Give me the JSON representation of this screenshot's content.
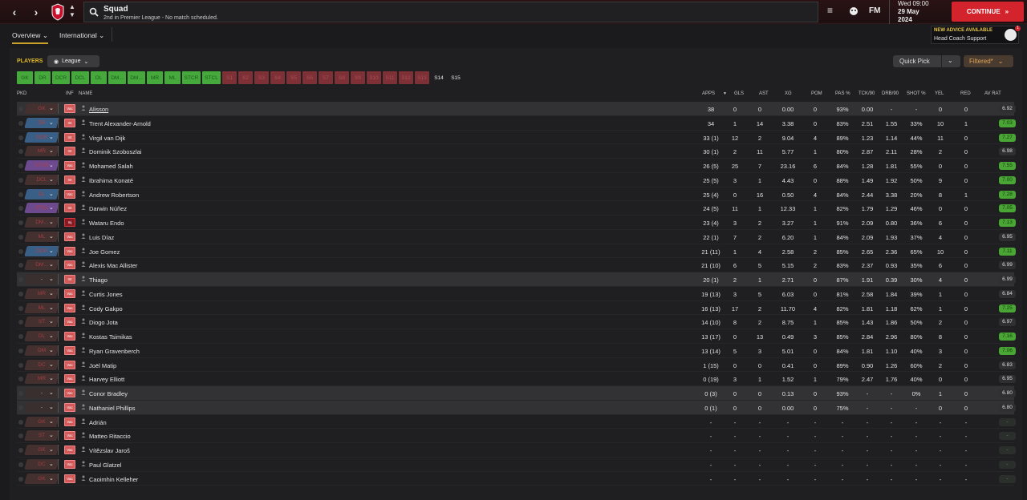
{
  "topbar": {
    "title": "Squad",
    "subtitle": "2nd in Premier League - No match scheduled.",
    "fm_label": "FM",
    "day_time": "Wed 09:00",
    "date_line1": "29 May",
    "date_line2": "2024",
    "continue_label": "CONTINUE",
    "accent": "#d3232d"
  },
  "tabs": {
    "overview": "Overview",
    "international": "International"
  },
  "advice": {
    "title": "NEW ADVICE AVAILABLE",
    "text": "Head Coach Support",
    "badge": "1"
  },
  "toolbar": {
    "players_label": "PLAYERS",
    "league": "League",
    "quick_pick": "Quick Pick",
    "filtered": "Filtered*"
  },
  "positions": [
    {
      "label": "GK",
      "state": "g"
    },
    {
      "label": "DR",
      "state": "g"
    },
    {
      "label": "DCR",
      "state": "g"
    },
    {
      "label": "DCL",
      "state": "g"
    },
    {
      "label": "DL",
      "state": "g"
    },
    {
      "label": "DM...",
      "state": "g"
    },
    {
      "label": "DM...",
      "state": "g"
    },
    {
      "label": "MR",
      "state": "g"
    },
    {
      "label": "ML",
      "state": "g"
    },
    {
      "label": "STCR",
      "state": "g"
    },
    {
      "label": "STCL",
      "state": "g"
    },
    {
      "label": "S1",
      "state": "r"
    },
    {
      "label": "S2",
      "state": "r"
    },
    {
      "label": "S3",
      "state": "r"
    },
    {
      "label": "S4",
      "state": "r"
    },
    {
      "label": "S5",
      "state": "r"
    },
    {
      "label": "S6",
      "state": "r"
    },
    {
      "label": "S7",
      "state": "r"
    },
    {
      "label": "S8",
      "state": "r"
    },
    {
      "label": "S9",
      "state": "r"
    },
    {
      "label": "S10",
      "state": "r"
    },
    {
      "label": "S11",
      "state": "r"
    },
    {
      "label": "S12",
      "state": "r"
    },
    {
      "label": "S13",
      "state": "r"
    },
    {
      "label": "S14",
      "state": "d"
    },
    {
      "label": "S15",
      "state": "d"
    }
  ],
  "columns": {
    "pkd": "PKD",
    "inf": "INF",
    "name": "NAME",
    "apps": "APPS",
    "gls": "GLS",
    "ast": "AST",
    "xg": "XG",
    "pom": "POM",
    "pas": "PAS %",
    "tck": "TCK/90",
    "drb": "DRB/90",
    "shot": "SHOT %",
    "yel": "YEL",
    "red": "RED",
    "avrat": "AV RAT"
  },
  "players": [
    {
      "pos": "GK",
      "pc": "brown",
      "inf": "Vac",
      "name": "Alisson",
      "apps": "38",
      "gls": "0",
      "ast": "0",
      "xg": "0.00",
      "pom": "0",
      "pas": "93%",
      "tck": "0.00",
      "drb": "-",
      "shot": "-",
      "yel": "0",
      "red": "0",
      "rat": "6.92",
      "rc": "grey",
      "hl": true
    },
    {
      "pos": "DR",
      "pc": "blue",
      "inf": "Int",
      "name": "Trent Alexander-Arnold",
      "apps": "34",
      "gls": "1",
      "ast": "14",
      "xg": "3.38",
      "pom": "0",
      "pas": "83%",
      "tck": "2.51",
      "drb": "1.55",
      "shot": "33%",
      "yel": "10",
      "red": "1",
      "rat": "7.03",
      "rc": "green"
    },
    {
      "pos": "DCR",
      "pc": "blue",
      "inf": "Int",
      "name": "Virgil van Dijk",
      "apps": "33 (1)",
      "gls": "12",
      "ast": "2",
      "xg": "9.04",
      "pom": "4",
      "pas": "89%",
      "tck": "1.23",
      "drb": "1.14",
      "shot": "44%",
      "yel": "11",
      "red": "0",
      "rat": "7.27",
      "rc": "green"
    },
    {
      "pos": "MR",
      "pc": "brown",
      "inf": "Int",
      "name": "Dominik Szoboszlai",
      "apps": "30 (1)",
      "gls": "2",
      "ast": "11",
      "xg": "5.77",
      "pom": "1",
      "pas": "80%",
      "tck": "2.87",
      "drb": "2.11",
      "shot": "28%",
      "yel": "2",
      "red": "0",
      "rat": "6.98",
      "rc": "grey"
    },
    {
      "pos": "STCR",
      "pc": "purple",
      "inf": "Vac",
      "name": "Mohamed Salah",
      "apps": "26 (5)",
      "gls": "25",
      "ast": "7",
      "xg": "23.16",
      "pom": "6",
      "pas": "84%",
      "tck": "1.28",
      "drb": "1.81",
      "shot": "55%",
      "yel": "0",
      "red": "0",
      "rat": "7.55",
      "rc": "green"
    },
    {
      "pos": "DCL",
      "pc": "brown",
      "inf": "Int",
      "name": "Ibrahima Konaté",
      "apps": "25 (5)",
      "gls": "3",
      "ast": "1",
      "xg": "4.43",
      "pom": "0",
      "pas": "88%",
      "tck": "1.49",
      "drb": "1.92",
      "shot": "50%",
      "yel": "9",
      "red": "0",
      "rat": "7.00",
      "rc": "green"
    },
    {
      "pos": "DL",
      "pc": "blue",
      "inf": "Vac",
      "name": "Andrew Robertson",
      "apps": "25 (4)",
      "gls": "0",
      "ast": "16",
      "xg": "0.50",
      "pom": "4",
      "pas": "84%",
      "tck": "2.44",
      "drb": "3.38",
      "shot": "20%",
      "yel": "8",
      "red": "1",
      "rat": "7.28",
      "rc": "green"
    },
    {
      "pos": "STCL",
      "pc": "purple",
      "inf": "Int",
      "name": "Darwin Núñez",
      "apps": "24 (5)",
      "gls": "11",
      "ast": "1",
      "xg": "12.33",
      "pom": "1",
      "pas": "82%",
      "tck": "1.79",
      "drb": "1.29",
      "shot": "46%",
      "yel": "0",
      "red": "0",
      "rat": "7.05",
      "rc": "green"
    },
    {
      "pos": "DM...",
      "pc": "brown",
      "inf": "Inj",
      "inf_dark": true,
      "name": "Wataru Endo",
      "apps": "23 (4)",
      "gls": "3",
      "ast": "2",
      "xg": "3.27",
      "pom": "1",
      "pas": "91%",
      "tck": "2.09",
      "drb": "0.80",
      "shot": "36%",
      "yel": "6",
      "red": "0",
      "rat": "7.13",
      "rc": "green"
    },
    {
      "pos": "ML",
      "pc": "brown",
      "inf": "Vac",
      "name": "Luis Díaz",
      "apps": "22 (1)",
      "gls": "7",
      "ast": "2",
      "xg": "6.20",
      "pom": "1",
      "pas": "84%",
      "tck": "2.09",
      "drb": "1.93",
      "shot": "37%",
      "yel": "4",
      "red": "0",
      "rat": "6.95",
      "rc": "grey"
    },
    {
      "pos": "DCR",
      "pc": "blue",
      "inf": "Vac",
      "name": "Joe Gomez",
      "apps": "21 (11)",
      "gls": "1",
      "ast": "4",
      "xg": "2.58",
      "pom": "2",
      "pas": "85%",
      "tck": "2.65",
      "drb": "2.36",
      "shot": "65%",
      "yel": "10",
      "red": "0",
      "rat": "7.11",
      "rc": "green"
    },
    {
      "pos": "DM...",
      "pc": "brown",
      "inf": "Vac",
      "name": "Alexis Mac Allister",
      "apps": "21 (10)",
      "gls": "6",
      "ast": "5",
      "xg": "5.15",
      "pom": "2",
      "pas": "83%",
      "tck": "2.37",
      "drb": "0.93",
      "shot": "35%",
      "yel": "6",
      "red": "0",
      "rat": "6.99",
      "rc": "grey"
    },
    {
      "pos": "-",
      "pc": "dark",
      "inf": "Int",
      "name": "Thiago",
      "apps": "20 (1)",
      "gls": "2",
      "ast": "1",
      "xg": "2.71",
      "pom": "0",
      "pas": "87%",
      "tck": "1.91",
      "drb": "0.39",
      "shot": "30%",
      "yel": "4",
      "red": "0",
      "rat": "6.99",
      "rc": "grey",
      "hl": true
    },
    {
      "pos": "MR",
      "pc": "brown",
      "inf": "Vac",
      "name": "Curtis Jones",
      "apps": "19 (13)",
      "gls": "3",
      "ast": "5",
      "xg": "6.03",
      "pom": "0",
      "pas": "81%",
      "tck": "2.58",
      "drb": "1.84",
      "shot": "39%",
      "yel": "1",
      "red": "0",
      "rat": "6.84",
      "rc": "grey"
    },
    {
      "pos": "ML",
      "pc": "brown",
      "inf": "Vac",
      "name": "Cody Gakpo",
      "apps": "16 (13)",
      "gls": "17",
      "ast": "2",
      "xg": "11.70",
      "pom": "4",
      "pas": "82%",
      "tck": "1.81",
      "drb": "1.18",
      "shot": "62%",
      "yel": "1",
      "red": "0",
      "rat": "7.25",
      "rc": "green"
    },
    {
      "pos": "ST",
      "pc": "brown",
      "inf": "Vac",
      "name": "Diogo Jota",
      "apps": "14 (10)",
      "gls": "8",
      "ast": "2",
      "xg": "8.75",
      "pom": "1",
      "pas": "85%",
      "tck": "1.43",
      "drb": "1.86",
      "shot": "50%",
      "yel": "2",
      "red": "0",
      "rat": "6.97",
      "rc": "grey"
    },
    {
      "pos": "DL",
      "pc": "brown",
      "inf": "Vac",
      "name": "Kostas Tsimikas",
      "apps": "13 (17)",
      "gls": "0",
      "ast": "13",
      "xg": "0.49",
      "pom": "3",
      "pas": "85%",
      "tck": "2.84",
      "drb": "2.96",
      "shot": "80%",
      "yel": "8",
      "red": "0",
      "rat": "7.16",
      "rc": "green"
    },
    {
      "pos": "DM",
      "pc": "brown",
      "inf": "Vac",
      "name": "Ryan Gravenberch",
      "apps": "13 (14)",
      "gls": "5",
      "ast": "3",
      "xg": "5.01",
      "pom": "0",
      "pas": "84%",
      "tck": "1.81",
      "drb": "1.10",
      "shot": "40%",
      "yel": "3",
      "red": "0",
      "rat": "7.06",
      "rc": "green"
    },
    {
      "pos": "DC",
      "pc": "brown",
      "inf": "Vac",
      "name": "Joël Matip",
      "apps": "1 (15)",
      "gls": "0",
      "ast": "0",
      "xg": "0.41",
      "pom": "0",
      "pas": "89%",
      "tck": "0.90",
      "drb": "1.26",
      "shot": "60%",
      "yel": "2",
      "red": "0",
      "rat": "6.83",
      "rc": "grey"
    },
    {
      "pos": "MR",
      "pc": "brown",
      "inf": "Vac",
      "name": "Harvey Elliott",
      "apps": "0 (19)",
      "gls": "3",
      "ast": "1",
      "xg": "1.52",
      "pom": "1",
      "pas": "79%",
      "tck": "2.47",
      "drb": "1.76",
      "shot": "40%",
      "yel": "0",
      "red": "0",
      "rat": "6.95",
      "rc": "grey"
    },
    {
      "pos": "-",
      "pc": "dark",
      "inf": "Vac",
      "name": "Conor Bradley",
      "apps": "0 (3)",
      "gls": "0",
      "ast": "0",
      "xg": "0.13",
      "pom": "0",
      "pas": "93%",
      "tck": "-",
      "drb": "-",
      "shot": "0%",
      "yel": "1",
      "red": "0",
      "rat": "6.80",
      "rc": "grey",
      "hl": true
    },
    {
      "pos": "-",
      "pc": "dark",
      "inf": "Vac",
      "name": "Nathaniel Phillips",
      "apps": "0 (1)",
      "gls": "0",
      "ast": "0",
      "xg": "0.00",
      "pom": "0",
      "pas": "75%",
      "tck": "-",
      "drb": "-",
      "shot": "-",
      "yel": "0",
      "red": "0",
      "rat": "6.80",
      "rc": "grey",
      "hl": true
    },
    {
      "pos": "GK",
      "pc": "brown",
      "inf": "Vac",
      "name": "Adrián",
      "apps": "-",
      "gls": "-",
      "ast": "-",
      "xg": "-",
      "pom": "-",
      "pas": "-",
      "tck": "-",
      "drb": "-",
      "shot": "-",
      "yel": "-",
      "red": "-",
      "rat": "-",
      "rc": "empty"
    },
    {
      "pos": "ST",
      "pc": "brown",
      "inf": "Vac",
      "name": "Matteo Ritaccio",
      "apps": "-",
      "gls": "-",
      "ast": "-",
      "xg": "-",
      "pom": "-",
      "pas": "-",
      "tck": "-",
      "drb": "-",
      "shot": "-",
      "yel": "-",
      "red": "-",
      "rat": "-",
      "rc": "empty"
    },
    {
      "pos": "GK",
      "pc": "brown",
      "inf": "Vac",
      "name": "Vítězslav Jaroš",
      "apps": "-",
      "gls": "-",
      "ast": "-",
      "xg": "-",
      "pom": "-",
      "pas": "-",
      "tck": "-",
      "drb": "-",
      "shot": "-",
      "yel": "-",
      "red": "-",
      "rat": "-",
      "rc": "empty"
    },
    {
      "pos": "DC",
      "pc": "brown",
      "inf": "Vac",
      "name": "Paul Glatzel",
      "apps": "-",
      "gls": "-",
      "ast": "-",
      "xg": "-",
      "pom": "-",
      "pas": "-",
      "tck": "-",
      "drb": "-",
      "shot": "-",
      "yel": "-",
      "red": "-",
      "rat": "-",
      "rc": "empty"
    },
    {
      "pos": "GK",
      "pc": "brown",
      "inf": "Vac",
      "name": "Caoimhin Kelleher",
      "apps": "-",
      "gls": "-",
      "ast": "-",
      "xg": "-",
      "pom": "-",
      "pas": "-",
      "tck": "-",
      "drb": "-",
      "shot": "-",
      "yel": "-",
      "red": "-",
      "rat": "-",
      "rc": "empty"
    }
  ]
}
